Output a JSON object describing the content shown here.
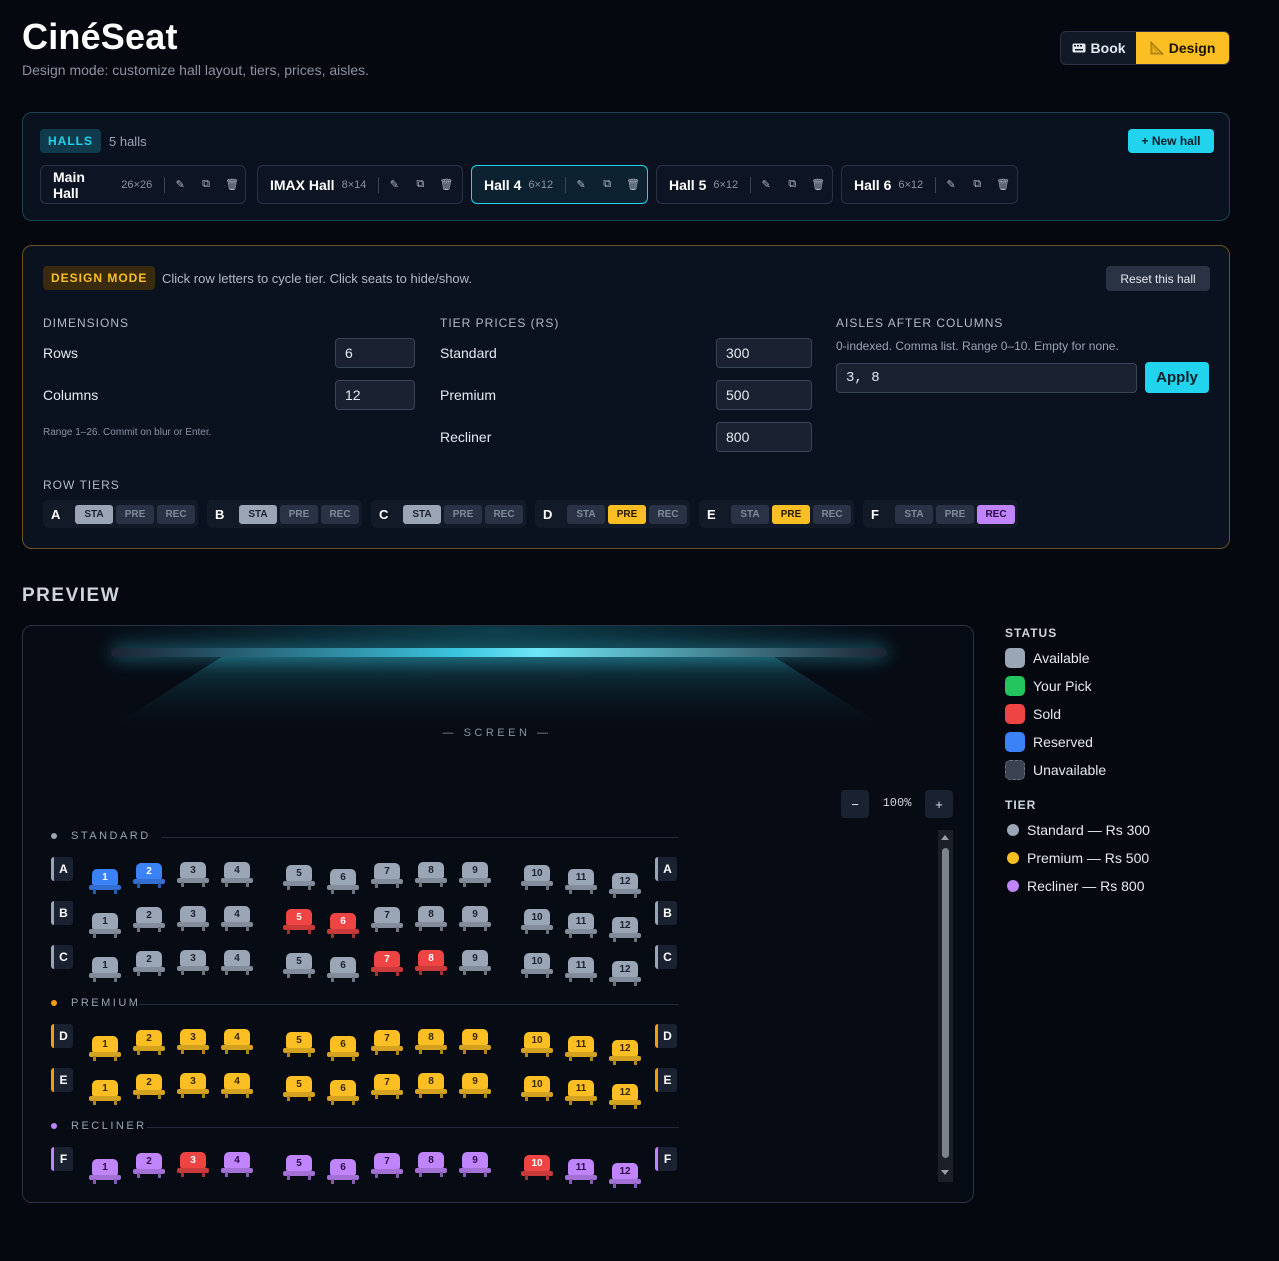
{
  "header": {
    "title": "CinéSeat",
    "subtitle": "Design mode: customize hall layout, tiers, prices, aisles.",
    "mode_book": "Book",
    "mode_design": "Design",
    "book_icon": "keyboard-icon",
    "design_icon": "ruler-icon"
  },
  "halls": {
    "badge": "HALLS",
    "count": "5 halls",
    "new_hall_label": "+ New hall",
    "items": [
      {
        "name": "Main Hall",
        "dim": "26×26"
      },
      {
        "name": "IMAX Hall",
        "dim": "8×14"
      },
      {
        "name": "Hall 4",
        "dim": "6×12",
        "active": true
      },
      {
        "name": "Hall 5",
        "dim": "6×12"
      },
      {
        "name": "Hall 6",
        "dim": "6×12"
      }
    ],
    "actions": [
      "✎",
      "⧉",
      "🗑"
    ]
  },
  "design": {
    "badge": "DESIGN MODE",
    "hint": "Click row letters to cycle tier. Click seats to hide/show.",
    "reset_label": "Reset this hall",
    "dimensions": {
      "title": "DIMENSIONS",
      "rows_label": "Rows",
      "rows_value": "6",
      "cols_label": "Columns",
      "cols_value": "12",
      "note": "Range 1–26. Commit on blur or Enter."
    },
    "prices": {
      "title": "TIER PRICES (RS)",
      "standard_label": "Standard",
      "standard_value": "300",
      "premium_label": "Premium",
      "premium_value": "500",
      "recliner_label": "Recliner",
      "recliner_value": "800"
    },
    "aisles": {
      "title": "AISLES AFTER COLUMNS",
      "note": "0-indexed. Comma list. Range 0–10. Empty for none.",
      "value": "3, 8",
      "apply_label": "Apply"
    },
    "row_tiers_title": "ROW TIERS",
    "tier_options": [
      "STA",
      "PRE",
      "REC"
    ],
    "row_tiers": [
      {
        "row": "A",
        "tier": "STA"
      },
      {
        "row": "B",
        "tier": "STA"
      },
      {
        "row": "C",
        "tier": "STA"
      },
      {
        "row": "D",
        "tier": "PRE"
      },
      {
        "row": "E",
        "tier": "PRE"
      },
      {
        "row": "F",
        "tier": "REC"
      }
    ]
  },
  "preview": {
    "title": "PREVIEW",
    "screen_label": "— SCREEN —",
    "zoom_out": "−",
    "zoom_level": "100%",
    "zoom_in": "+",
    "sections": [
      {
        "label": "STANDARD",
        "tier": "standard",
        "rows": [
          {
            "row": "A",
            "seats": [
              "reserved",
              "reserved",
              "available",
              "available",
              "available",
              "available",
              "available",
              "available",
              "available",
              "available",
              "available",
              "available"
            ]
          },
          {
            "row": "B",
            "seats": [
              "available",
              "available",
              "available",
              "available",
              "sold",
              "sold",
              "available",
              "available",
              "available",
              "available",
              "available",
              "available"
            ]
          },
          {
            "row": "C",
            "seats": [
              "available",
              "available",
              "available",
              "available",
              "available",
              "available",
              "sold",
              "sold",
              "available",
              "available",
              "available",
              "available"
            ]
          }
        ]
      },
      {
        "label": "PREMIUM",
        "tier": "premium",
        "rows": [
          {
            "row": "D",
            "seats": [
              "available",
              "available",
              "available",
              "available",
              "available",
              "available",
              "available",
              "available",
              "available",
              "available",
              "available",
              "available"
            ]
          },
          {
            "row": "E",
            "seats": [
              "available",
              "available",
              "available",
              "available",
              "available",
              "available",
              "available",
              "available",
              "available",
              "available",
              "available",
              "available"
            ]
          }
        ]
      },
      {
        "label": "RECLINER",
        "tier": "recliner",
        "rows": [
          {
            "row": "F",
            "seats": [
              "available",
              "available",
              "sold",
              "available",
              "available",
              "available",
              "available",
              "available",
              "available",
              "sold",
              "available",
              "available"
            ]
          }
        ]
      }
    ]
  },
  "legend": {
    "status_title": "STATUS",
    "status_items": [
      {
        "label": "Available",
        "color": "#9aa5b5"
      },
      {
        "label": "Your Pick",
        "color": "#22c55e"
      },
      {
        "label": "Sold",
        "color": "#ef4444"
      },
      {
        "label": "Reserved",
        "color": "#3b82f6"
      },
      {
        "label": "Unavailable",
        "color": "#3a4252"
      }
    ],
    "tier_title": "TIER",
    "tier_items": [
      {
        "label": "Standard — Rs 300",
        "color": "#9aa5b5"
      },
      {
        "label": "Premium — Rs 500",
        "color": "#fbbf24"
      },
      {
        "label": "Recliner — Rs 800",
        "color": "#c084fc"
      }
    ]
  },
  "colors": {
    "standard": "#9aa5b5",
    "premium": "#fbbf24",
    "recliner": "#c084fc",
    "sold": "#ef4444",
    "reserved": "#3b82f6",
    "accent": "#22d3ee"
  }
}
